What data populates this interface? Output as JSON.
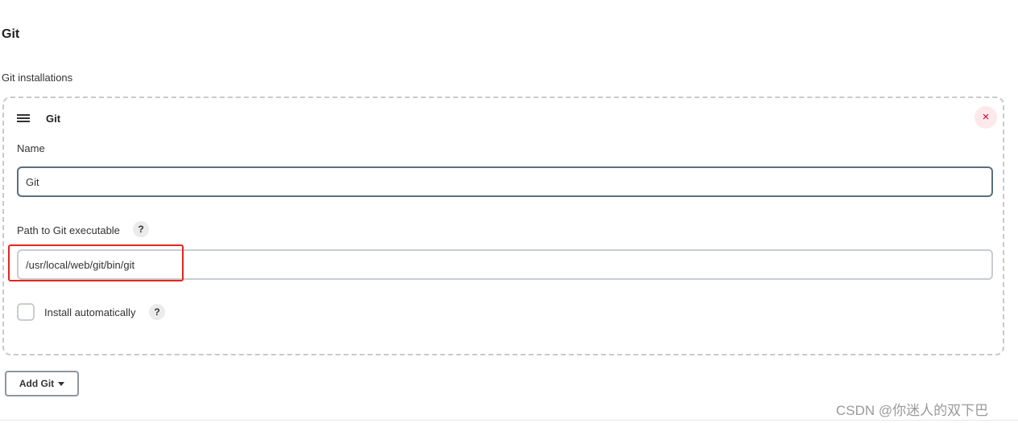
{
  "section": {
    "title": "Git",
    "installations_label": "Git installations"
  },
  "installation": {
    "title": "Git",
    "delete_icon": "×",
    "name_label": "Name",
    "name_value": "Git",
    "path_label": "Path to Git executable",
    "path_value": "/usr/local/web/git/bin/git",
    "help_icon": "?",
    "install_auto_label": "Install automatically",
    "install_auto_checked": false
  },
  "add_button": {
    "label": "Add Git"
  },
  "watermark": "CSDN @你迷人的双下巴",
  "colors": {
    "highlight": "#e5261d",
    "delete": "#d0021b",
    "delete_bg": "#fde8ec",
    "focus_border": "#5a6f80"
  }
}
